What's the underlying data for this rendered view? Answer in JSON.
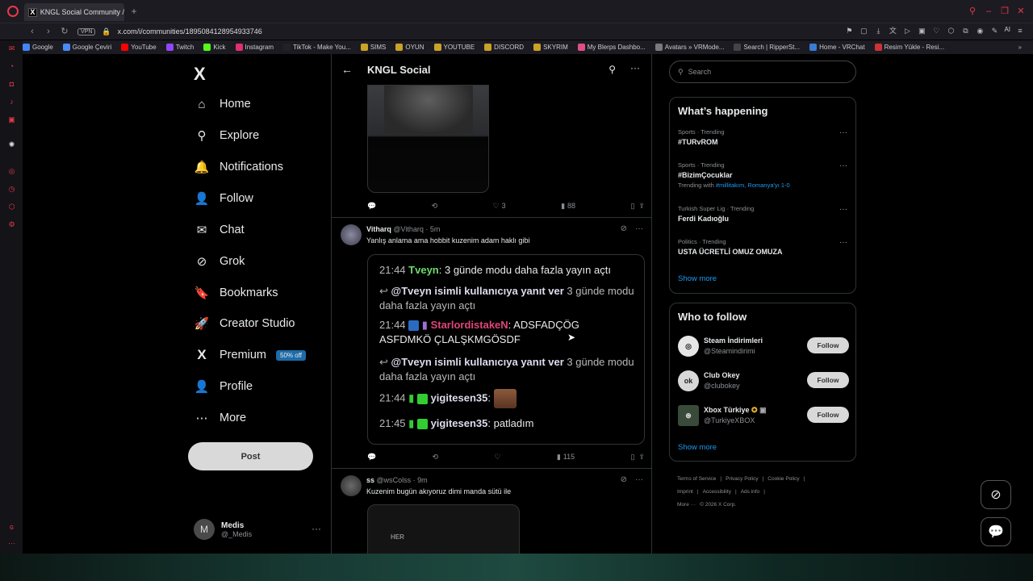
{
  "browser": {
    "tab_title": "KNGL Social Community /",
    "url": "x.com/i/communities/1895084128954933746",
    "vpn_label": "VPN",
    "ai_label": "AI",
    "bookmarks": [
      "Google",
      "Google Çeviri",
      "YouTube",
      "Twitch",
      "Kick",
      "Instagram",
      "TikTok - Make You...",
      "SIMS",
      "OYUN",
      "YOUTUBE",
      "DISCORD",
      "SKYRIM",
      "My Blerps Dashbo...",
      "Avatars » VRMode...",
      "Search | RipperSt...",
      "Home - VRChat",
      "Resim Yükle - Resi..."
    ],
    "bookmark_colors": [
      "#4285f4",
      "#4a8af4",
      "#ff0000",
      "#9146ff",
      "#53fc18",
      "#e1306c",
      "#222222",
      "#c9a227",
      "#c9a227",
      "#c9a227",
      "#c9a227",
      "#c9a227",
      "#e04e8a",
      "#7a7a7a",
      "#444444",
      "#3a7bd5",
      "#cc3333"
    ],
    "sidebar_icons": [
      "messenger-icon",
      "whatsapp-icon",
      "instagram-icon",
      "music-icon",
      "chatgpt-icon",
      "player-icon",
      "history-icon",
      "extensions-icon",
      "settings-icon"
    ]
  },
  "nav": {
    "logo": "X",
    "items": [
      {
        "label": "Home",
        "icon": "⌂"
      },
      {
        "label": "Explore",
        "icon": "⚲"
      },
      {
        "label": "Notifications",
        "icon": "🔔"
      },
      {
        "label": "Follow",
        "icon": "👤"
      },
      {
        "label": "Chat",
        "icon": "✉"
      },
      {
        "label": "Grok",
        "icon": "⊘"
      },
      {
        "label": "Bookmarks",
        "icon": "🔖"
      },
      {
        "label": "Creator Studio",
        "icon": "🚀"
      },
      {
        "label": "Premium",
        "icon": "X"
      },
      {
        "label": "Profile",
        "icon": "👤"
      },
      {
        "label": "More",
        "icon": "⋯"
      }
    ],
    "premium_badge": "50% off",
    "post_label": "Post",
    "account": {
      "initial": "M",
      "name": "Medis",
      "handle": "@_Medis",
      "more": "···"
    }
  },
  "feed": {
    "title": "KNGL Social",
    "tweet1_actions": {
      "likes": "3",
      "views": "88"
    },
    "tweet2": {
      "name": "Vitharq",
      "handle": "@Vitharq",
      "time": "5m",
      "text": "Yanlış anlama ama hobbit kuzenim adam haklı gibi",
      "views": "115"
    },
    "chat": {
      "l1_time": "21:44",
      "l1_name": "Tveyn",
      "l1_text": ": 3 günde modu daha fazla yayın açtı",
      "l2_reply": "@Tveyn isimli kullanıcıya yanıt ver",
      "l2_text_a": " 3 günde modu",
      "l2_text_b": "daha fazla yayın açtı",
      "l3_time": "21:44",
      "l3_name": "StarlordistakeN",
      "l3_text_a": ": ADSFADÇÖG",
      "l3_text_b": "ASFDMKÖ ÇLALŞKMGÖSDF",
      "l4_reply": "@Tveyn isimli kullanıcıya yanıt ver",
      "l4_text_a": " 3 günde modu",
      "l4_text_b": "daha fazla yayın açtı",
      "l5_time": "21:44",
      "l5_name": "yigitesen35",
      "l5_text": ":",
      "l6_time": "21:45",
      "l6_name": "yigitesen35",
      "l6_text": ": patladım"
    },
    "tweet3": {
      "name": "ss",
      "handle": "@wsColss",
      "time": "9m",
      "text": "Kuzenim bugün akıyoruz dimi manda sütü ile",
      "image_text": "HER"
    }
  },
  "right": {
    "search_placeholder": "Search",
    "trending_title": "What’s happening",
    "trends": [
      {
        "meta": "Sports · Trending",
        "name": "#TURvROM",
        "sub": ""
      },
      {
        "meta": "Sports · Trending",
        "name": "#BizimÇocuklar",
        "sub_prefix": "Trending with ",
        "sub_links": "#millitakım, Romanya'yı 1-0"
      },
      {
        "meta": "Turkish Super Lig · Trending",
        "name": "Ferdi Kadıoğlu",
        "sub": ""
      },
      {
        "meta": "Politics · Trending",
        "name": "USTA ÜCRETLİ OMUZ OMUZA",
        "sub": ""
      }
    ],
    "show_more": "Show more",
    "who_title": "Who to follow",
    "who": [
      {
        "name": "Steam İndirimleri",
        "handle": "@Steamindirimi",
        "follow": "Follow"
      },
      {
        "name": "Club Okey",
        "handle": "@clubokey",
        "follow": "Follow"
      },
      {
        "name": "Xbox Türkiye",
        "handle": "@TurkiyeXBOX",
        "follow": "Follow"
      }
    ],
    "footer": [
      "Terms of Service",
      "|",
      "Privacy Policy",
      "|",
      "Cookie Policy",
      "|",
      "Imprint",
      "|",
      "Accessibility",
      "|",
      "Ads info",
      "|",
      "More ···",
      "© 2026 X Corp."
    ]
  }
}
